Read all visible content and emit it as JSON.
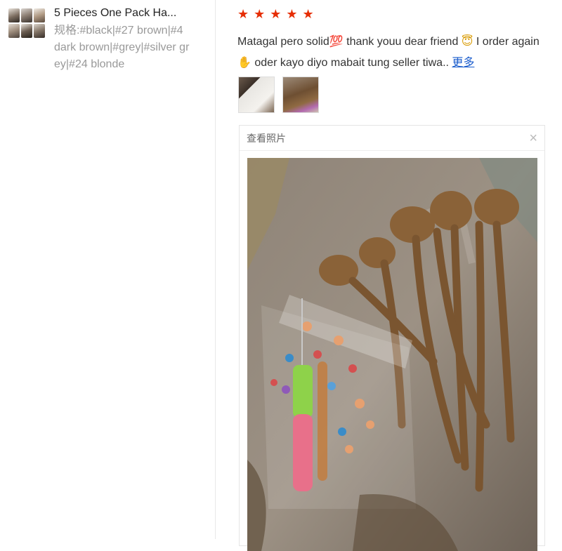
{
  "product": {
    "title": "5 Pieces One Pack Ha...",
    "variant": "规格:#black|#27 brown|#4 dark brown|#grey|#silver grey|#24 blonde"
  },
  "review": {
    "stars": "★★★★★",
    "text_part1": "Matagal pero solid",
    "emoji1": "💯",
    "text_part2": " thank youu dear friend ",
    "emoji2": "😇",
    "text_part3": " I order again",
    "emoji3": "✋",
    "text_part4": " oder kayo diyo mabait tung seller tiwa..",
    "more_label": "更多"
  },
  "viewer": {
    "title": "查看照片",
    "close_icon": "×"
  },
  "colors": {
    "star": "#e62e04",
    "link": "#1a5ccc",
    "muted": "#999999"
  }
}
